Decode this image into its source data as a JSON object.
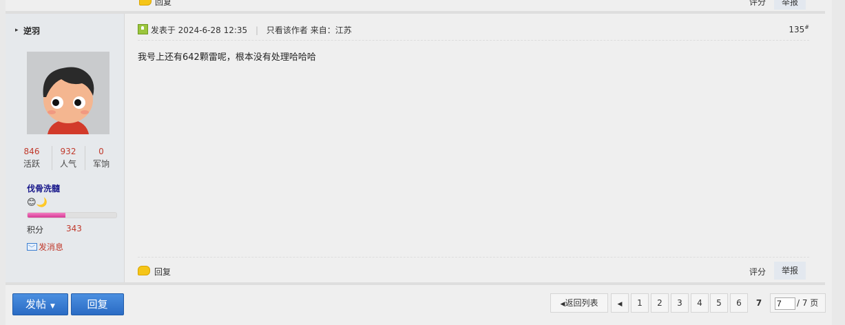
{
  "previous_post": {
    "reply_label": "回复",
    "rate_label": "评分",
    "report_label": "举报"
  },
  "author": {
    "name": "逆羽",
    "stats": [
      {
        "value": "846",
        "label": "活跃"
      },
      {
        "value": "932",
        "label": "人气"
      },
      {
        "value": "0",
        "label": "军饷"
      }
    ],
    "rank_title": "伐骨洗髓",
    "rank_icons": "😊🌙",
    "points_label": "积分",
    "points_value": "343",
    "message_label": "发消息"
  },
  "post": {
    "posted_label": "发表于",
    "date": "2024-6-28 12:35",
    "only_author_label": "只看该作者",
    "from_label": "来自：江苏",
    "floor_number": "135",
    "floor_mark": "#",
    "body": "我号上还有642颗雷呢，根本没有处理哈哈哈",
    "reply_label": "回复",
    "rate_label": "评分",
    "report_label": "举报"
  },
  "toolbar": {
    "new_post_label": "发帖",
    "reply_label": "回复"
  },
  "pagination": {
    "back_label": "返回列表",
    "pages": [
      "1",
      "2",
      "3",
      "4",
      "5",
      "6",
      "7"
    ],
    "current_page": "7",
    "input_value": "7",
    "total_label": "/ 7 页"
  }
}
